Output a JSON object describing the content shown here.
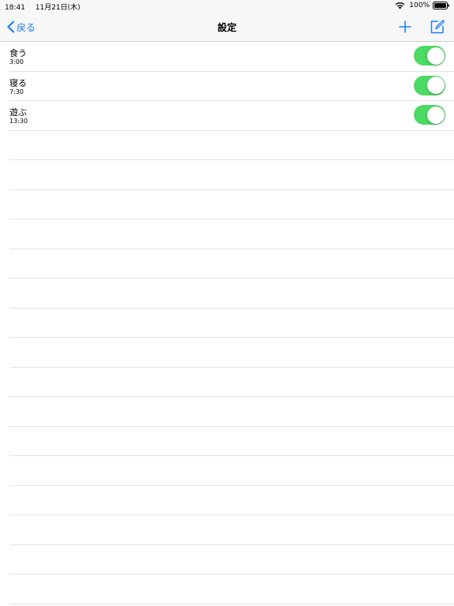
{
  "status": {
    "time": "18:41",
    "date": "11月21日(木)",
    "battery": "100%"
  },
  "nav": {
    "back_label": "戻る",
    "title": "設定"
  },
  "colors": {
    "accent": "#1a7ef5",
    "toggle_on": "#4cd964"
  },
  "items": [
    {
      "title": "食う",
      "time": "3:00",
      "enabled": true
    },
    {
      "title": "寝る",
      "time": "7:30",
      "enabled": true
    },
    {
      "title": "遊ぶ",
      "time": "13:30",
      "enabled": true
    }
  ]
}
